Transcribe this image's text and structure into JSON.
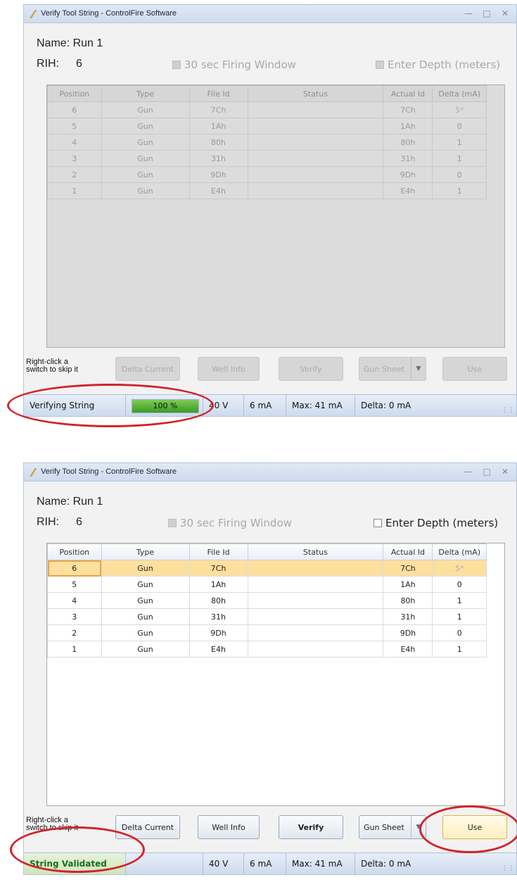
{
  "window": {
    "title": "Verify Tool String - ControlFire Software",
    "name_label": "Name:",
    "name_value": "Run 1",
    "rih_label": "RIH:",
    "rih_value": "6",
    "firing_window_label": "30 sec Firing Window",
    "enter_depth_label": "Enter Depth (meters)",
    "hint": "Right-click a switch to skip it",
    "columns": [
      "Position",
      "Type",
      "File Id",
      "Status",
      "Actual Id",
      "Delta (mA)"
    ],
    "rows": [
      {
        "position": "6",
        "type": "Gun",
        "file_id": "7Ch",
        "status": "",
        "actual_id": "7Ch",
        "delta": "5*"
      },
      {
        "position": "5",
        "type": "Gun",
        "file_id": "1Ah",
        "status": "",
        "actual_id": "1Ah",
        "delta": "0"
      },
      {
        "position": "4",
        "type": "Gun",
        "file_id": "80h",
        "status": "",
        "actual_id": "80h",
        "delta": "1"
      },
      {
        "position": "3",
        "type": "Gun",
        "file_id": "31h",
        "status": "",
        "actual_id": "31h",
        "delta": "1"
      },
      {
        "position": "2",
        "type": "Gun",
        "file_id": "9Dh",
        "status": "",
        "actual_id": "9Dh",
        "delta": "0"
      },
      {
        "position": "1",
        "type": "Gun",
        "file_id": "E4h",
        "status": "",
        "actual_id": "E4h",
        "delta": "1"
      }
    ],
    "buttons": {
      "delta_current": "Delta Current",
      "well_info": "Well Info",
      "verify": "Verify",
      "gun_sheet": "Gun Sheet",
      "use": "Use"
    },
    "status": {
      "voltage": "40 V",
      "current": "6 mA",
      "max": "Max: 41 mA",
      "delta": "Delta: 0 mA"
    }
  },
  "top": {
    "status_text": "Verifying String",
    "progress_text": "100 %",
    "progress_value": 1.0,
    "state": "disabled"
  },
  "bottom": {
    "status_text": "String Validated",
    "selected_row": 0,
    "state": "enabled"
  },
  "colors": {
    "highlight_circle": "#d2232a",
    "selected_row": "#fddf9e",
    "progress_fill": "#3b9a24"
  }
}
